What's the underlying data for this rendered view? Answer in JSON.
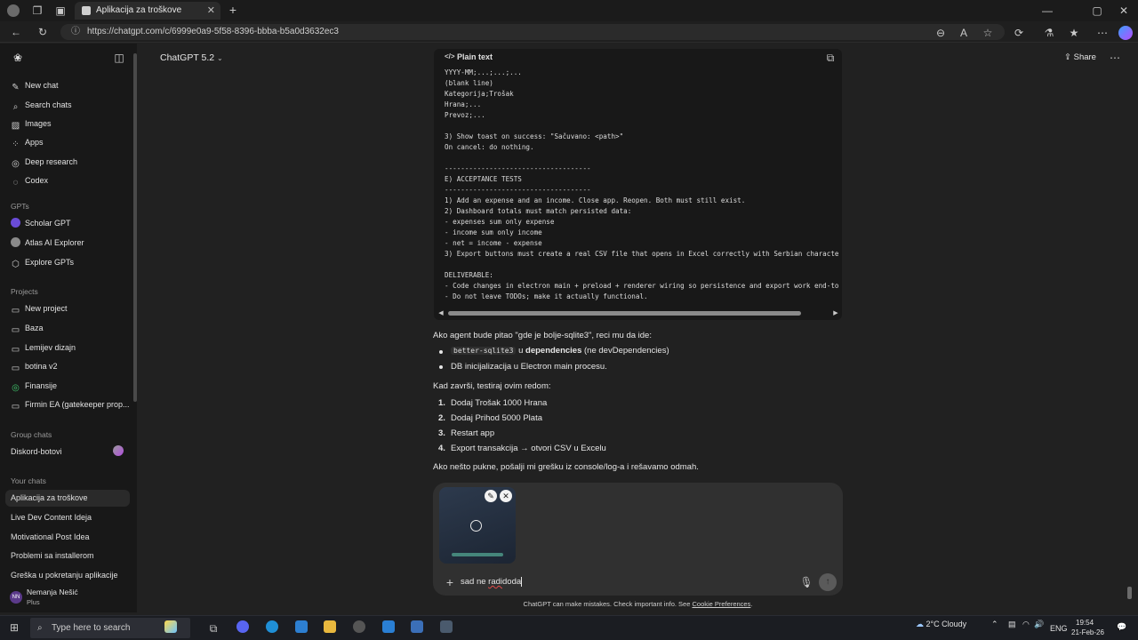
{
  "browser": {
    "tab_title": "Aplikacija za troškove",
    "url": "https://chatgpt.com/c/6999e0a9-5f58-8396-bbba-b5a0d3632ec3"
  },
  "header": {
    "model": "ChatGPT 5.2",
    "share": "Share"
  },
  "sidebar": {
    "top_items": [
      {
        "label": "New chat",
        "icon": "pencil-icon"
      },
      {
        "label": "Search chats",
        "icon": "search-icon"
      },
      {
        "label": "Images",
        "icon": "image-icon"
      },
      {
        "label": "Apps",
        "icon": "apps-icon"
      },
      {
        "label": "Deep research",
        "icon": "telescope-icon"
      },
      {
        "label": "Codex",
        "icon": "codex-icon"
      }
    ],
    "gpts_head": "GPTs",
    "gpts": [
      "Scholar GPT",
      "Atlas AI Explorer",
      "Explore GPTs"
    ],
    "projects_head": "Projects",
    "projects": [
      "New project",
      "Baza",
      "Lemijev dizajn",
      "botina v2",
      "Finansije",
      "Firmin EA (gatekeeper prop..."
    ],
    "group_head": "Group chats",
    "group": [
      "Diskord-botovi"
    ],
    "chats_head": "Your chats",
    "chats": [
      "Aplikacija za troškove",
      "Live Dev Content Ideja",
      "Motivational Post Idea",
      "Problemi sa installerom",
      "Greška u pokretanju aplikacije"
    ],
    "user_name": "Nemanja Nešić",
    "user_initials": "NN",
    "user_plan": "Plus"
  },
  "code": {
    "header": "Plain text",
    "lines": [
      "YYYY-MM;...;...;...",
      "(blank line)",
      "Kategorija;Trošak",
      "Hrana;...",
      "Prevoz;...",
      "",
      "3) Show toast on success: \"Sačuvano: <path>\"",
      "On cancel: do nothing.",
      "",
      "------------------------------------",
      "E) ACCEPTANCE TESTS",
      "------------------------------------",
      "1) Add an expense and an income. Close app. Reopen. Both must still exist.",
      "2) Dashboard totals must match persisted data:",
      "- expenses sum only expense",
      "- income sum only income",
      "- net = income - expense",
      "3) Export buttons must create a real CSV file that opens in Excel correctly with Serbian characte",
      "",
      "DELIVERABLE:",
      "- Code changes in electron main + preload + renderer wiring so persistence and export work end-to",
      "- Do not leave TODOs; make it actually functional."
    ]
  },
  "message": {
    "intro": "Ako agent bude pitao \"gde je bolje-sqlite3\", reci mu da ide:",
    "bullet1_code": "better-sqlite3",
    "bullet1_mid": "u",
    "bullet1_bold": "dependencies",
    "bullet1_rest": "(ne devDependencies)",
    "bullet2": "DB inicijalizacija u Electron main procesu.",
    "test_intro": "Kad završi, testiraj ovim redom:",
    "steps": [
      "Dodaj Trošak 1000 Hrana",
      "Dodaj Prihod 5000 Plata",
      "Restart app",
      "Export transakcija → otvori CSV u Excelu"
    ],
    "outro": "Ako nešto pukne, pošalji mi grešku iz console/log-a i rešavamo odmah."
  },
  "composer": {
    "text_before": "sad ne",
    "text_error": "radi",
    "text_after": "doda"
  },
  "footer": {
    "text": "ChatGPT can make mistakes. Check important info. See",
    "link": "Cookie Preferences",
    "end": "."
  },
  "taskbar": {
    "search_placeholder": "Type here to search",
    "weather": "2°C  Cloudy",
    "lang": "ENG",
    "time": "19:54",
    "date": "21-Feb-26"
  }
}
